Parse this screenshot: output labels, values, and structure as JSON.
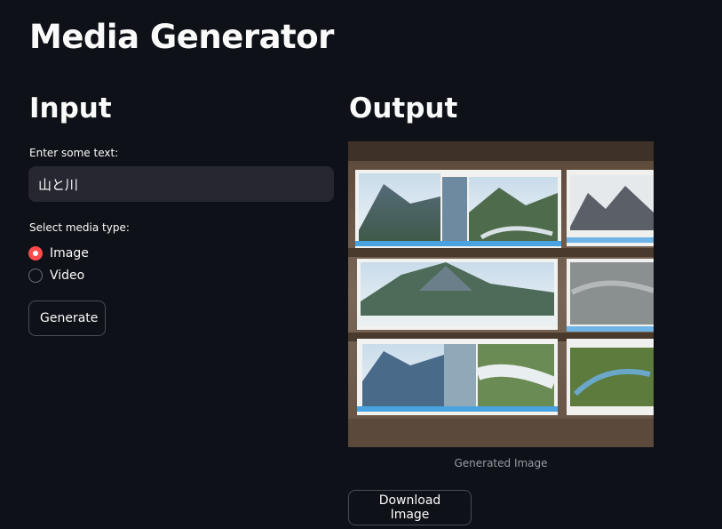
{
  "app": {
    "title": "Media Generator"
  },
  "input": {
    "title": "Input",
    "text_label": "Enter some text:",
    "text_value": "山と川",
    "media_label": "Select media type:",
    "options": [
      {
        "label": "Image",
        "selected": true
      },
      {
        "label": "Video",
        "selected": false
      }
    ],
    "generate_label": "Generate"
  },
  "output": {
    "title": "Output",
    "caption": "Generated Image",
    "download_label": "Download Image"
  },
  "colors": {
    "background": "#0e1117",
    "input_bg": "#262730",
    "accent": "#ff4b4b",
    "text": "#fafafa",
    "caption": "#9a9ca3"
  }
}
